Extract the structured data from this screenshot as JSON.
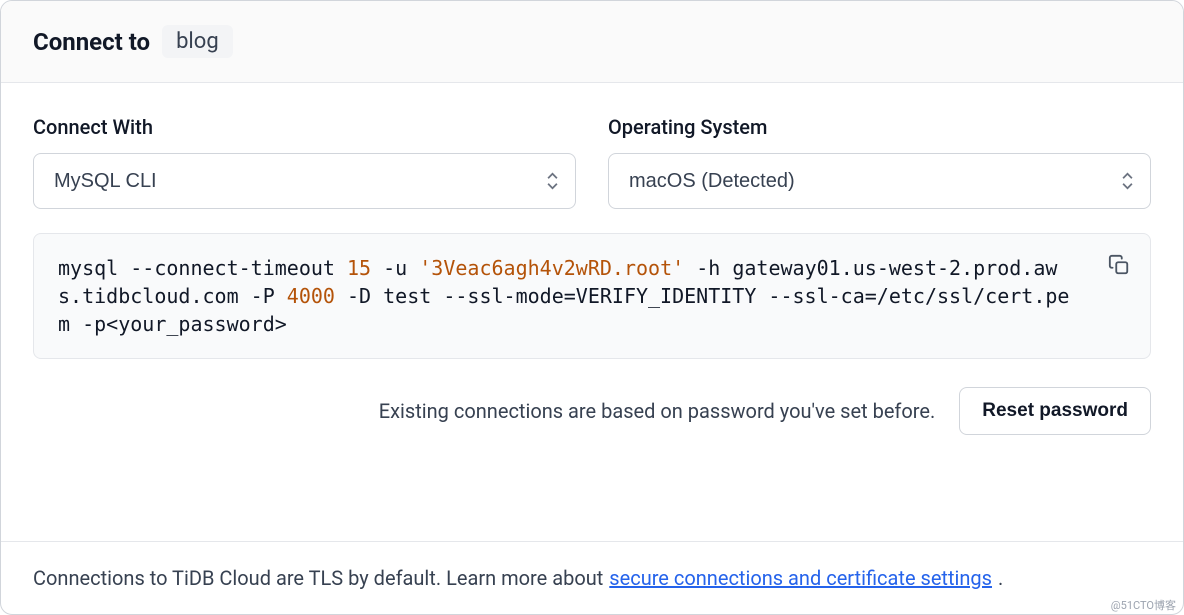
{
  "header": {
    "title_prefix": "Connect to",
    "cluster_name": "blog"
  },
  "form": {
    "connect_with_label": "Connect With",
    "connect_with_value": "MySQL CLI",
    "os_label": "Operating System",
    "os_value": "macOS (Detected)"
  },
  "command": {
    "parts": {
      "p1": "mysql --connect-timeout ",
      "timeout": "15",
      "p2": " -u ",
      "user": "'3Veac6agh4v2wRD.root'",
      "p3": " -h gateway01.us-west-2.prod.aws.tidbcloud.com -P ",
      "port": "4000",
      "p4": " -D test --ssl-mode=VERIFY_IDENTITY --ssl-ca=/etc/ssl/cert.pem -p<your_password>"
    }
  },
  "password": {
    "hint": "Existing connections are based on password you've set before.",
    "reset_label": "Reset password"
  },
  "footer": {
    "text_prefix": "Connections to TiDB Cloud are TLS by default. Learn more about ",
    "link_text": "secure connections and certificate settings",
    "text_suffix": "."
  },
  "watermark": "@51CTO博客"
}
